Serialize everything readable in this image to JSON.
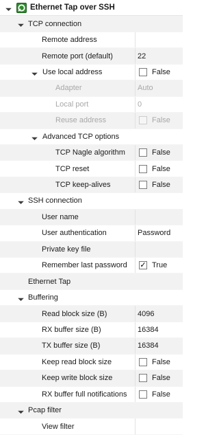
{
  "tree": {
    "rows": [
      {
        "label": "Ethernet Tap over SSH",
        "value": null,
        "checkbox": null,
        "checked": false,
        "level": 0,
        "expander": "expanded",
        "bold": true,
        "disabled": false,
        "icon": "ethernet-tap-icon"
      },
      {
        "label": "TCP connection",
        "value": null,
        "checkbox": null,
        "checked": false,
        "level": 1,
        "expander": "expanded",
        "bold": false,
        "disabled": false
      },
      {
        "label": "Remote address",
        "value": "",
        "checkbox": null,
        "checked": false,
        "level": 3,
        "expander": null,
        "bold": false,
        "disabled": false
      },
      {
        "label": "Remote port (default)",
        "value": "22",
        "checkbox": null,
        "checked": false,
        "level": 3,
        "expander": null,
        "bold": false,
        "disabled": false
      },
      {
        "label": "Use local address",
        "value": "False",
        "checkbox": true,
        "checked": false,
        "level": 2,
        "expander": "expanded",
        "bold": false,
        "disabled": false
      },
      {
        "label": "Adapter",
        "value": "Auto",
        "checkbox": null,
        "checked": false,
        "level": 4,
        "expander": null,
        "bold": false,
        "disabled": true
      },
      {
        "label": "Local port",
        "value": "0",
        "checkbox": null,
        "checked": false,
        "level": 4,
        "expander": null,
        "bold": false,
        "disabled": true
      },
      {
        "label": "Reuse address",
        "value": "False",
        "checkbox": true,
        "checked": false,
        "level": 4,
        "expander": null,
        "bold": false,
        "disabled": true
      },
      {
        "label": "Advanced TCP options",
        "value": null,
        "checkbox": null,
        "checked": false,
        "level": 2,
        "expander": "expanded",
        "bold": false,
        "disabled": false
      },
      {
        "label": "TCP Nagle algorithm",
        "value": "False",
        "checkbox": true,
        "checked": false,
        "level": 4,
        "expander": null,
        "bold": false,
        "disabled": false
      },
      {
        "label": "TCP reset",
        "value": "False",
        "checkbox": true,
        "checked": false,
        "level": 4,
        "expander": null,
        "bold": false,
        "disabled": false
      },
      {
        "label": "TCP keep-alives",
        "value": "False",
        "checkbox": true,
        "checked": false,
        "level": 4,
        "expander": null,
        "bold": false,
        "disabled": false
      },
      {
        "label": "SSH connection",
        "value": null,
        "checkbox": null,
        "checked": false,
        "level": 1,
        "expander": "expanded",
        "bold": false,
        "disabled": false
      },
      {
        "label": "User name",
        "value": "",
        "checkbox": null,
        "checked": false,
        "level": 3,
        "expander": null,
        "bold": false,
        "disabled": false
      },
      {
        "label": "User authentication",
        "value": "Password",
        "checkbox": null,
        "checked": false,
        "level": 3,
        "expander": null,
        "bold": false,
        "disabled": false
      },
      {
        "label": "Private key file",
        "value": "",
        "checkbox": null,
        "checked": false,
        "level": 3,
        "expander": null,
        "bold": false,
        "disabled": false
      },
      {
        "label": "Remember last password",
        "value": "True",
        "checkbox": true,
        "checked": true,
        "level": 3,
        "expander": null,
        "bold": false,
        "disabled": false
      },
      {
        "label": "Ethernet Tap",
        "value": null,
        "checkbox": null,
        "checked": false,
        "level": 1,
        "expander": null,
        "bold": false,
        "disabled": false
      },
      {
        "label": "Buffering",
        "value": null,
        "checkbox": null,
        "checked": false,
        "level": 1,
        "expander": "expanded",
        "bold": false,
        "disabled": false
      },
      {
        "label": "Read block size (B)",
        "value": "4096",
        "checkbox": null,
        "checked": false,
        "level": 3,
        "expander": null,
        "bold": false,
        "disabled": false
      },
      {
        "label": "RX buffer size (B)",
        "value": "16384",
        "checkbox": null,
        "checked": false,
        "level": 3,
        "expander": null,
        "bold": false,
        "disabled": false
      },
      {
        "label": "TX buffer size (B)",
        "value": "16384",
        "checkbox": null,
        "checked": false,
        "level": 3,
        "expander": null,
        "bold": false,
        "disabled": false
      },
      {
        "label": "Keep read block size",
        "value": "False",
        "checkbox": true,
        "checked": false,
        "level": 3,
        "expander": null,
        "bold": false,
        "disabled": false
      },
      {
        "label": "Keep write block size",
        "value": "False",
        "checkbox": true,
        "checked": false,
        "level": 3,
        "expander": null,
        "bold": false,
        "disabled": false
      },
      {
        "label": "RX buffer full notifications",
        "value": "False",
        "checkbox": true,
        "checked": false,
        "level": 3,
        "expander": null,
        "bold": false,
        "disabled": false
      },
      {
        "label": "Pcap filter",
        "value": null,
        "checkbox": null,
        "checked": false,
        "level": 1,
        "expander": "expanded",
        "bold": false,
        "disabled": false
      },
      {
        "label": "View filter",
        "value": "",
        "checkbox": null,
        "checked": false,
        "level": 3,
        "expander": null,
        "bold": false,
        "disabled": false
      }
    ]
  },
  "icons": {
    "expanded": "expand-arrow-icon",
    "checkmark": "checkmark-icon"
  },
  "colors": {
    "alt_row": "#f2f2f2",
    "disabled_text": "#a8a8a8",
    "icon_green": "#2e8b2e"
  }
}
